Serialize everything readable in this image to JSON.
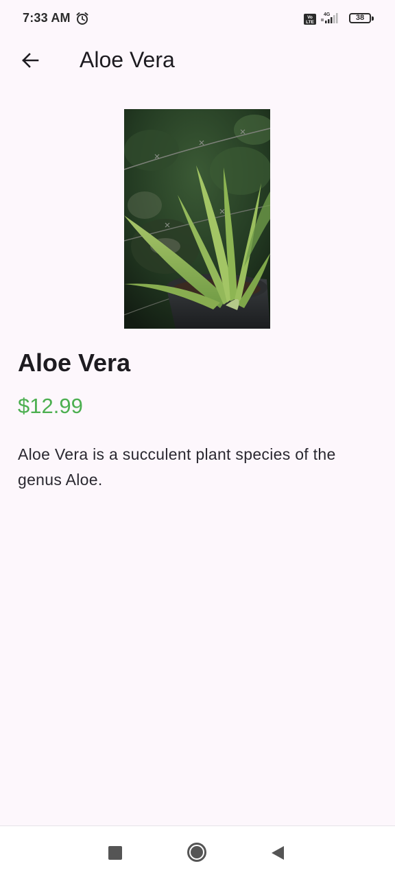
{
  "status_bar": {
    "time": "7:33 AM",
    "network_label": "4G",
    "volte_label": "Vo LTE",
    "battery_level": "38"
  },
  "app_bar": {
    "title": "Aloe Vera",
    "back_icon": "arrow-left-icon"
  },
  "product": {
    "name": "Aloe Vera",
    "price": "$12.99",
    "description": "Aloe Vera is a succulent plant species of the genus Aloe.",
    "price_color": "#4caf50"
  },
  "nav_bar": {
    "recents_icon": "square-icon",
    "home_icon": "circle-icon",
    "back_icon": "triangle-back-icon"
  }
}
